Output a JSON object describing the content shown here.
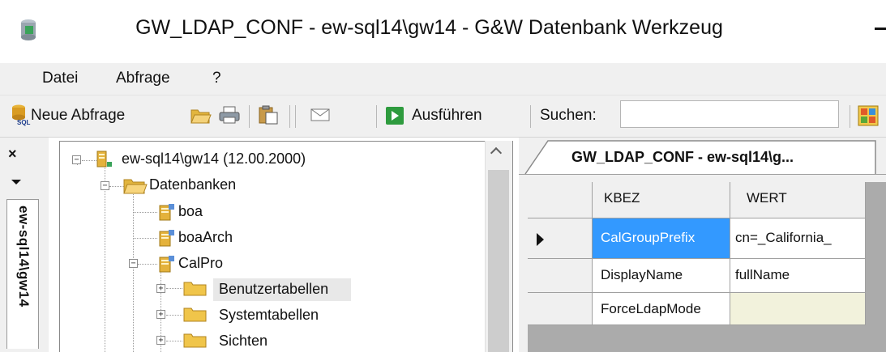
{
  "window": {
    "title": "GW_LDAP_CONF - ew-sql14\\gw14 - G&W Datenbank Werkzeug"
  },
  "menu": {
    "items": [
      "Datei",
      "Abfrage",
      "?"
    ]
  },
  "toolbar": {
    "new_query_label": "Neue Abfrage",
    "execute_label": "Ausführen",
    "search_label": "Suchen:",
    "search_value": ""
  },
  "side_panel": {
    "close_glyph": "×",
    "tab_label": "ew-sql14\\gw14"
  },
  "tree": {
    "server": "ew-sql14\\gw14 (12.00.2000)",
    "databases_folder": "Datenbanken",
    "db_boa": "boa",
    "db_boaarch": "boaArch",
    "db_calpro": "CalPro",
    "folder_user_tables": "Benutzertabellen",
    "folder_system_tables": "Systemtabellen",
    "folder_views": "Sichten"
  },
  "document": {
    "tab_label": "GW_LDAP_CONF - ew-sql14\\g...",
    "columns": [
      "KBEZ",
      "WERT"
    ],
    "rows": [
      {
        "kbez": "CalGroupPrefix",
        "wert": "cn=_California_"
      },
      {
        "kbez": "DisplayName",
        "wert": "fullName"
      },
      {
        "kbez": "ForceLdapMode",
        "wert": ""
      }
    ]
  },
  "colors": {
    "selection": "#3399ff",
    "new_row": "#f2f2dc",
    "grid_background": "#ababab"
  }
}
